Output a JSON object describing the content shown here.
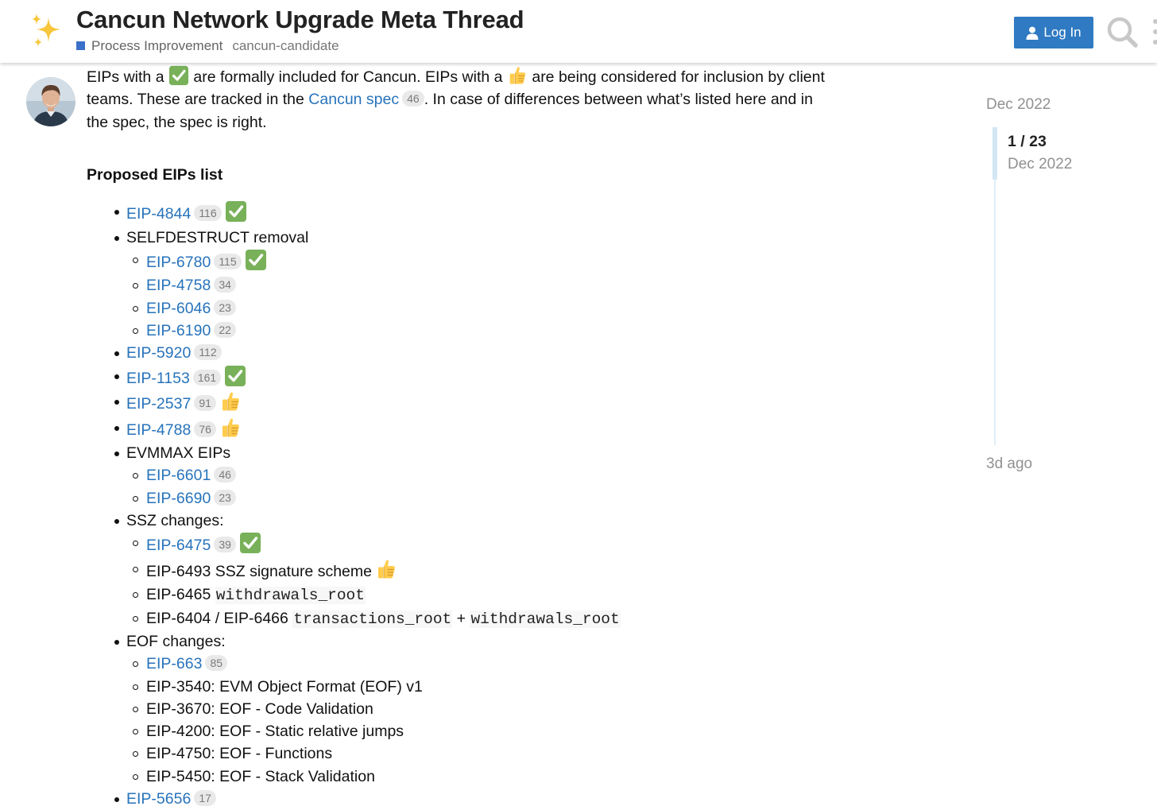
{
  "header": {
    "title": "Cancun Network Upgrade Meta Thread",
    "category": "Process Improvement",
    "tag": "cancun-candidate",
    "login_label": "Log In",
    "colors": {
      "category": "#3a70c9",
      "login_bg": "#2f7ac2",
      "link": "#2773bb"
    },
    "icons": [
      "sparkles-icon",
      "user-icon",
      "search-icon",
      "menu-dots-icon"
    ]
  },
  "post": {
    "intro": {
      "t1": "EIPs with a",
      "t2": "are formally included for Cancun. EIPs with a",
      "t3": "are being considered for inclusion by client teams. These are tracked in the",
      "link": "Cancun spec",
      "link_count": "46",
      "t4": ". In case of differences between what’s listed here and in the spec, the spec is right."
    },
    "heading": "Proposed EIPs list",
    "items": {
      "eip4844": {
        "label": "EIP-4844",
        "count": "116"
      },
      "selfdestruct": "SELFDESTRUCT removal",
      "eip6780": {
        "label": "EIP-6780",
        "count": "115"
      },
      "eip4758": {
        "label": "EIP-4758",
        "count": "34"
      },
      "eip6046": {
        "label": "EIP-6046",
        "count": "23"
      },
      "eip6190": {
        "label": "EIP-6190",
        "count": "22"
      },
      "eip5920": {
        "label": "EIP-5920",
        "count": "112"
      },
      "eip1153": {
        "label": "EIP-1153",
        "count": "161"
      },
      "eip2537": {
        "label": "EIP-2537",
        "count": "91"
      },
      "eip4788": {
        "label": "EIP-4788",
        "count": "76"
      },
      "evmmax": "EVMMAX EIPs",
      "eip6601": {
        "label": "EIP-6601",
        "count": "46"
      },
      "eip6690": {
        "label": "EIP-6690",
        "count": "23"
      },
      "ssz": "SSZ changes:",
      "eip6475": {
        "label": "EIP-6475",
        "count": "39"
      },
      "eip6493": "EIP-6493 SSZ signature scheme",
      "eip6465": {
        "text": "EIP-6465",
        "code": "withdrawals_root"
      },
      "eip6404": {
        "text": "EIP-6404 / EIP-6466",
        "code1": "transactions_root",
        "plus": "+",
        "code2": "withdrawals_root"
      },
      "eof": "EOF changes:",
      "eip663": {
        "label": "EIP-663",
        "count": "85"
      },
      "eip3540": "EIP-3540: EVM Object Format (EOF) v1",
      "eip3670": "EIP-3670: EOF - Code Validation",
      "eip4200": "EIP-4200: EOF - Static relative jumps",
      "eip4750": "EIP-4750: EOF - Functions",
      "eip5450": "EIP-5450: EOF - Stack Validation",
      "eip5656": {
        "label": "EIP-5656",
        "count": "17"
      }
    }
  },
  "timeline": {
    "start": "Dec 2022",
    "position": "1 / 23",
    "position_date": "Dec 2022",
    "end": "3d ago"
  }
}
